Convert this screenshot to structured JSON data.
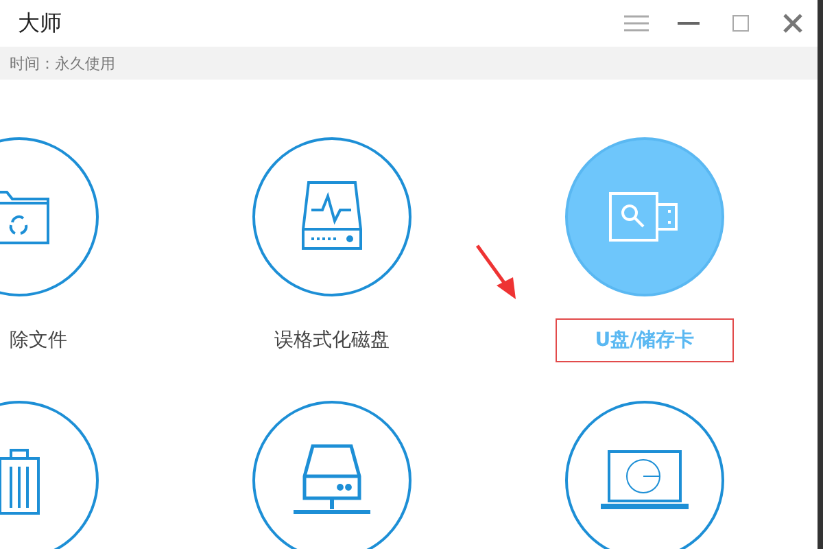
{
  "window": {
    "title": "大师"
  },
  "info_bar": {
    "text": "时间：永久使用"
  },
  "modes": [
    {
      "kind": "folder",
      "label": "除文件",
      "selected": false,
      "annotated": false
    },
    {
      "kind": "disk",
      "label": "误格式化磁盘",
      "selected": false,
      "annotated": false
    },
    {
      "kind": "usb",
      "label": "U盘/储存卡",
      "selected": true,
      "annotated": true
    },
    {
      "kind": "trash",
      "selected": false
    },
    {
      "kind": "network",
      "selected": false
    },
    {
      "kind": "laptop",
      "selected": false
    }
  ]
}
